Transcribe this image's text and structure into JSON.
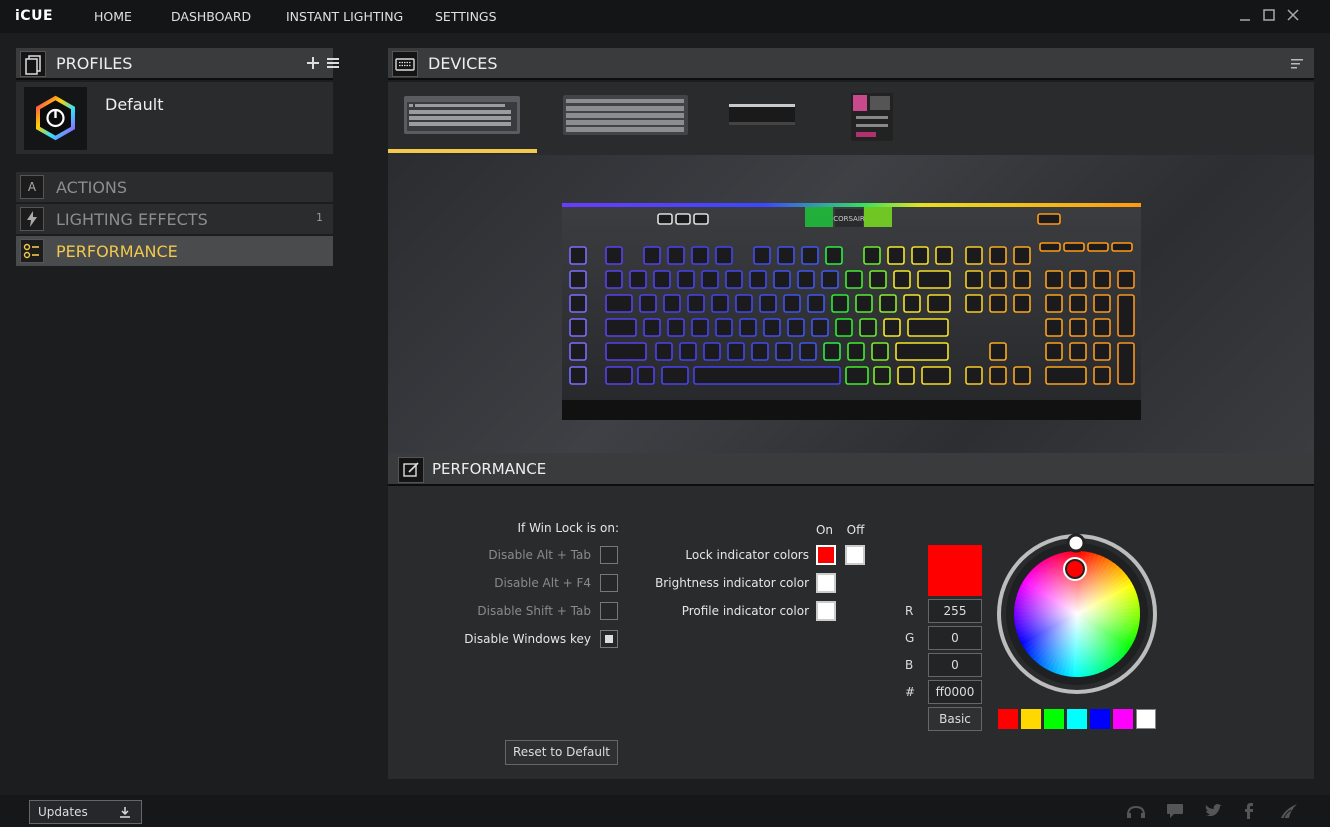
{
  "app": {
    "logo": "iCUE"
  },
  "nav": {
    "items": [
      "HOME",
      "DASHBOARD",
      "INSTANT LIGHTING",
      "SETTINGS"
    ]
  },
  "profiles": {
    "title": "PROFILES",
    "current": "Default"
  },
  "sections": [
    {
      "label": "ACTIONS",
      "count": ""
    },
    {
      "label": "LIGHTING EFFECTS",
      "count": "1"
    },
    {
      "label": "PERFORMANCE",
      "count": ""
    }
  ],
  "devices": {
    "title": "DEVICES"
  },
  "keyboard": {
    "brand_text": "CORSAIR"
  },
  "performance": {
    "title": "PERFORMANCE",
    "winlock_heading": "If Win Lock is on:",
    "options": [
      {
        "label": "Disable Alt + Tab",
        "checked": false
      },
      {
        "label": "Disable Alt + F4",
        "checked": false
      },
      {
        "label": "Disable Shift + Tab",
        "checked": false
      },
      {
        "label": "Disable Windows key",
        "checked": true
      }
    ],
    "col_on": "On",
    "col_off": "Off",
    "indicators": [
      {
        "label": "Lock indicator colors",
        "on_color": "#ff0000",
        "off_color": "#ffffff"
      },
      {
        "label": "Brightness indicator color",
        "color": "#ffffff"
      },
      {
        "label": "Profile indicator color",
        "color": "#ffffff"
      }
    ],
    "color": {
      "preview": "#ff0000",
      "r_label": "R",
      "r": "255",
      "g_label": "G",
      "g": "0",
      "b_label": "B",
      "b": "0",
      "hex_label": "#",
      "hex": "ff0000",
      "basic": "Basic"
    },
    "palette": [
      "#ff0000",
      "#ffd800",
      "#00ff00",
      "#00ffff",
      "#0000ff",
      "#ff00ff",
      "#ffffff"
    ],
    "reset": "Reset to Default"
  },
  "footer": {
    "updates": "Updates"
  },
  "icons": {
    "profiles": "profiles-icon",
    "devices": "keyboard-icon",
    "performance": "edit-icon",
    "actions": "action-icon",
    "lighting": "lightning-icon",
    "perf_nav": "performance-icon"
  }
}
